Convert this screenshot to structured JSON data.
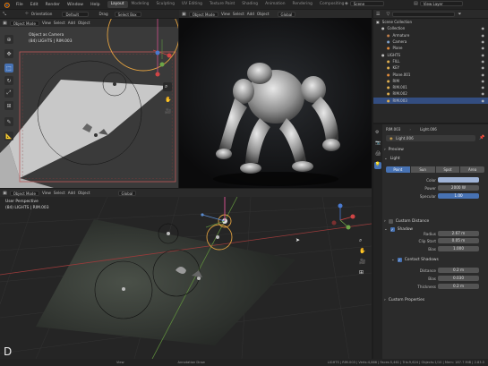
{
  "topbar": {
    "menus": [
      "File",
      "Edit",
      "Render",
      "Window",
      "Help"
    ],
    "workspaces": [
      "Layout",
      "Modeling",
      "Sculpting",
      "UV Editing",
      "Texture Paint",
      "Shading",
      "Animation",
      "Rendering",
      "Compositing"
    ],
    "active_workspace": "Layout",
    "scene": "Scene",
    "view_layer": "View Layer"
  },
  "tool_header": {
    "orientation_label": "Orientation",
    "orientation_value": "Default",
    "drag_label": "Drag",
    "drag_value": "Select Box"
  },
  "viewport_top_left": {
    "mode": "Object Mode",
    "menus": [
      "View",
      "Select",
      "Add",
      "Object"
    ],
    "overlay_line1": "Object as Camera",
    "overlay_line2": "(84) LIGHTS | RIM.003"
  },
  "viewport_top_mid": {
    "mode": "Object Mode",
    "menus": [
      "View",
      "Select",
      "Add",
      "Object"
    ],
    "orientation": "Global"
  },
  "viewport_bottom": {
    "mode": "Object Mode",
    "menus": [
      "View",
      "Select",
      "Add",
      "Object"
    ],
    "orientation": "Global",
    "overlay_line1": "User Perspective",
    "overlay_line2": "(84) LIGHTS | RIM.003"
  },
  "outliner": {
    "title": "Scene Collection",
    "rows": [
      {
        "name": "Collection",
        "indent": 1,
        "color": "#bdbdbd",
        "selected": false
      },
      {
        "name": "Armature",
        "indent": 2,
        "color": "#c17f4a",
        "selected": false
      },
      {
        "name": "Camera",
        "indent": 2,
        "color": "#7fa0c8",
        "selected": false
      },
      {
        "name": "Plane",
        "indent": 2,
        "color": "#e08a3a",
        "selected": false
      },
      {
        "name": "LIGHTS",
        "indent": 1,
        "color": "#bdbdbd",
        "selected": false
      },
      {
        "name": "FILL",
        "indent": 2,
        "color": "#e0b050",
        "selected": false
      },
      {
        "name": "KEY",
        "indent": 2,
        "color": "#e0b050",
        "selected": false
      },
      {
        "name": "Plane.001",
        "indent": 2,
        "color": "#e08a3a",
        "selected": false
      },
      {
        "name": "RIM",
        "indent": 2,
        "color": "#e0b050",
        "selected": false
      },
      {
        "name": "RIM.001",
        "indent": 2,
        "color": "#e0b050",
        "selected": false
      },
      {
        "name": "RIM.002",
        "indent": 2,
        "color": "#e0b050",
        "selected": false
      },
      {
        "name": "RIM.003",
        "indent": 2,
        "color": "#e0b050",
        "selected": true
      }
    ]
  },
  "properties": {
    "breadcrumb_object": "RIM.003",
    "breadcrumb_data": "Light.006",
    "datablock": "Light.006",
    "section_preview": "Preview",
    "section_light": "Light",
    "light_types": [
      "Point",
      "Sun",
      "Spot",
      "Area"
    ],
    "active_light_type": "Point",
    "fields": [
      {
        "label": "Color",
        "value": ""
      },
      {
        "label": "Power",
        "value": "2000 W"
      },
      {
        "label": "Specular",
        "value": "1.00"
      },
      {
        "label": "Radius",
        "value": "2.67 m"
      }
    ],
    "section_custom_distance": "Custom Distance",
    "section_shadow": "Shadow",
    "shadow_fields": [
      {
        "label": "Clip Start",
        "value": "0.05 m"
      },
      {
        "label": "Bias",
        "value": "1.000"
      }
    ],
    "section_contact_shadows": "Contact Shadows",
    "contact_fields": [
      {
        "label": "Distance",
        "value": "0.2 m"
      },
      {
        "label": "Bias",
        "value": "0.030"
      },
      {
        "label": "Thickness",
        "value": "0.2 m"
      }
    ],
    "section_custom_props": "Custom Properties"
  },
  "statusbar": {
    "view": "View",
    "annotation": "Annotation Draw",
    "stats": "LIGHTS | RIM.003 | Verts:4,886 | Faces:5,461 | Tris:9,624 | Objects:1/10 | Mem: 187.7 MiB | 2.83.5"
  },
  "keystroke": "D",
  "colors": {
    "accent": "#4772b3",
    "selection": "#334d80",
    "light_color_swatch": "#9fb3d6"
  }
}
